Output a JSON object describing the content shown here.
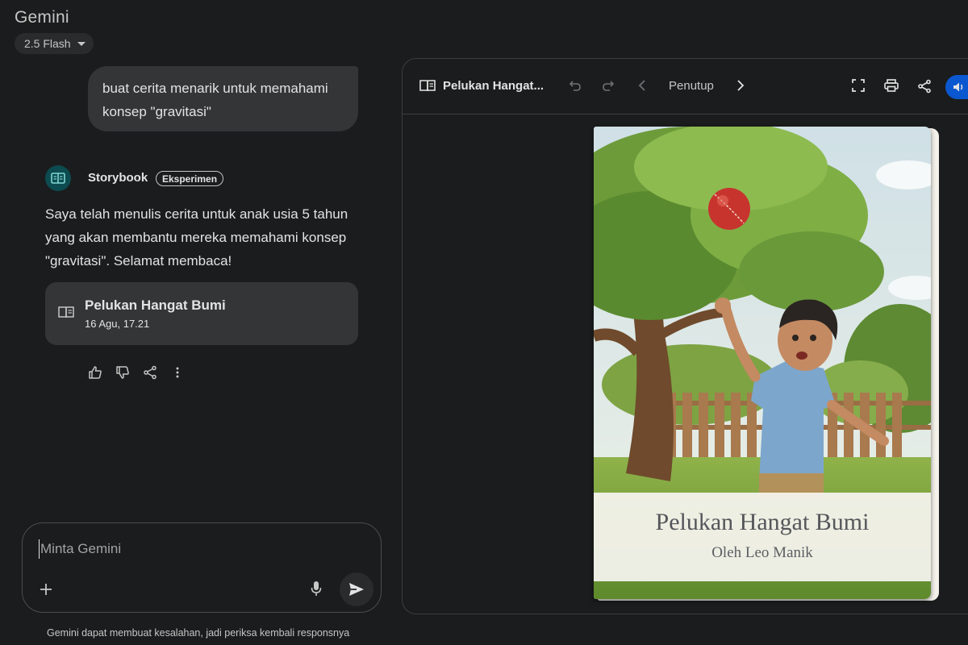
{
  "app": {
    "title": "Gemini",
    "model": "2.5 Flash"
  },
  "conversation": {
    "user_message": "buat cerita menarik untuk memahami konsep \"gravitasi\"",
    "bot_name": "Storybook",
    "badge": "Eksperimen",
    "bot_message": "Saya telah menulis cerita untuk anak usia 5 tahun yang akan membantu mereka memahami konsep \"gravitasi\". Selamat membaca!",
    "card": {
      "title": "Pelukan Hangat Bumi",
      "date": "16 Agu, 17.21"
    }
  },
  "input": {
    "placeholder": "Minta Gemini"
  },
  "disclaimer": "Gemini dapat membuat kesalahan, jadi periksa kembali responsnya",
  "canvas": {
    "title": "Pelukan Hangat...",
    "page_label": "Penutup"
  },
  "book": {
    "title": "Pelukan Hangat Bumi",
    "author": "Oleh Leo Manik"
  },
  "icons": {
    "toolbar": [
      "book-icon",
      "undo-icon",
      "redo-icon",
      "chevron-left-icon",
      "chevron-right-icon",
      "fullscreen-icon",
      "print-icon",
      "share-icon",
      "volume-icon"
    ],
    "feedback": [
      "thumb-up-icon",
      "thumb-down-icon",
      "share-icon",
      "more-vert-icon"
    ]
  },
  "colors": {
    "background": "#1b1c1d",
    "surface": "#333537",
    "accent": "#0b57d0",
    "avatar": "#0c4b4f"
  }
}
